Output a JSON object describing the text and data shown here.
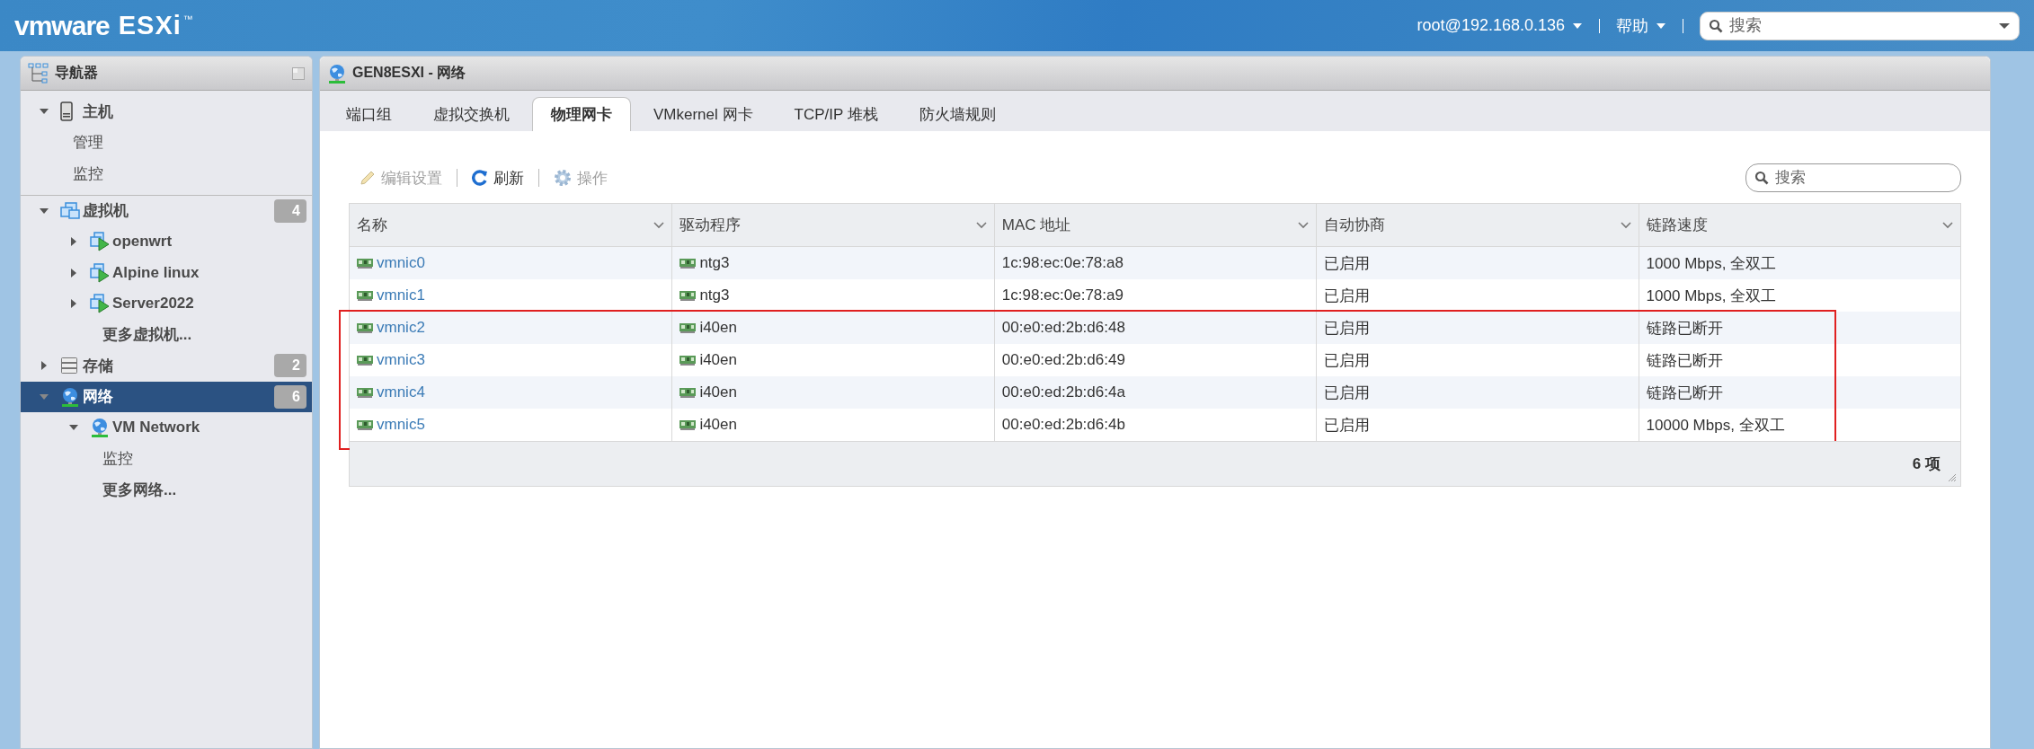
{
  "app": {
    "brand": "vmware",
    "product": "ESXi",
    "mark": "™"
  },
  "top_bar": {
    "user": "root@192.168.0.136",
    "help": "帮助",
    "search": {
      "placeholder": "搜索"
    }
  },
  "navigator": {
    "title": "导航器",
    "items": [
      {
        "label": "主机",
        "kind": "host",
        "expanded": true,
        "selected": false,
        "children": [
          {
            "label": "管理",
            "kind": "link"
          },
          {
            "label": "监控",
            "kind": "link"
          }
        ]
      },
      {
        "label": "虚拟机",
        "kind": "vms",
        "expanded": true,
        "selected": false,
        "count": "4",
        "children": [
          {
            "label": "openwrt",
            "kind": "vm",
            "expanded": false,
            "selected": false
          },
          {
            "label": "Alpine linux",
            "kind": "vm",
            "expanded": false,
            "selected": false
          },
          {
            "label": "Server2022",
            "kind": "vm",
            "expanded": false,
            "selected": false
          },
          {
            "label": "更多虚拟机...",
            "kind": "more"
          }
        ]
      },
      {
        "label": "存储",
        "kind": "storage",
        "expanded": false,
        "selected": false,
        "count": "2"
      },
      {
        "label": "网络",
        "kind": "network",
        "expanded": true,
        "selected": true,
        "count": "6",
        "children": [
          {
            "label": "VM Network",
            "kind": "network",
            "expanded": true,
            "selected": false,
            "children": [
              {
                "label": "监控",
                "kind": "link"
              }
            ]
          },
          {
            "label": "更多网络...",
            "kind": "more"
          }
        ]
      }
    ]
  },
  "panel": {
    "title": "GEN8ESXI - 网络",
    "tabs": [
      {
        "label": "端口组",
        "selected": false
      },
      {
        "label": "虚拟交换机",
        "selected": false
      },
      {
        "label": "物理网卡",
        "selected": true
      },
      {
        "label": "VMkernel 网卡",
        "selected": false
      },
      {
        "label": "TCP/IP 堆栈",
        "selected": false
      },
      {
        "label": "防火墙规则",
        "selected": false
      }
    ],
    "toolbar": [
      {
        "label": "编辑设置",
        "kind": "edit",
        "disabled": true
      },
      {
        "label": "刷新",
        "kind": "refresh",
        "disabled": false
      },
      {
        "label": "操作",
        "kind": "actions",
        "disabled": true
      }
    ],
    "search": {
      "placeholder": "搜索"
    },
    "table": {
      "columns": [
        "名称",
        "驱动程序",
        "MAC 地址",
        "自动协商",
        "链路速度"
      ],
      "rows": [
        {
          "cells": [
            "vmnic0",
            "ntg3",
            "1c:98:ec:0e:78:a8",
            "已启用",
            "1000 Mbps, 全双工"
          ],
          "highlighted": false
        },
        {
          "cells": [
            "vmnic1",
            "ntg3",
            "1c:98:ec:0e:78:a9",
            "已启用",
            "1000 Mbps, 全双工"
          ],
          "highlighted": false
        },
        {
          "cells": [
            "vmnic2",
            "i40en",
            "00:e0:ed:2b:d6:48",
            "已启用",
            "链路已断开"
          ],
          "highlighted": true
        },
        {
          "cells": [
            "vmnic3",
            "i40en",
            "00:e0:ed:2b:d6:49",
            "已启用",
            "链路已断开"
          ],
          "highlighted": true
        },
        {
          "cells": [
            "vmnic4",
            "i40en",
            "00:e0:ed:2b:d6:4a",
            "已启用",
            "链路已断开"
          ],
          "highlighted": true
        },
        {
          "cells": [
            "vmnic5",
            "i40en",
            "00:e0:ed:2b:d6:4b",
            "已启用",
            "10000 Mbps, 全双工"
          ],
          "highlighted": true
        }
      ],
      "footer": "6 项"
    }
  }
}
